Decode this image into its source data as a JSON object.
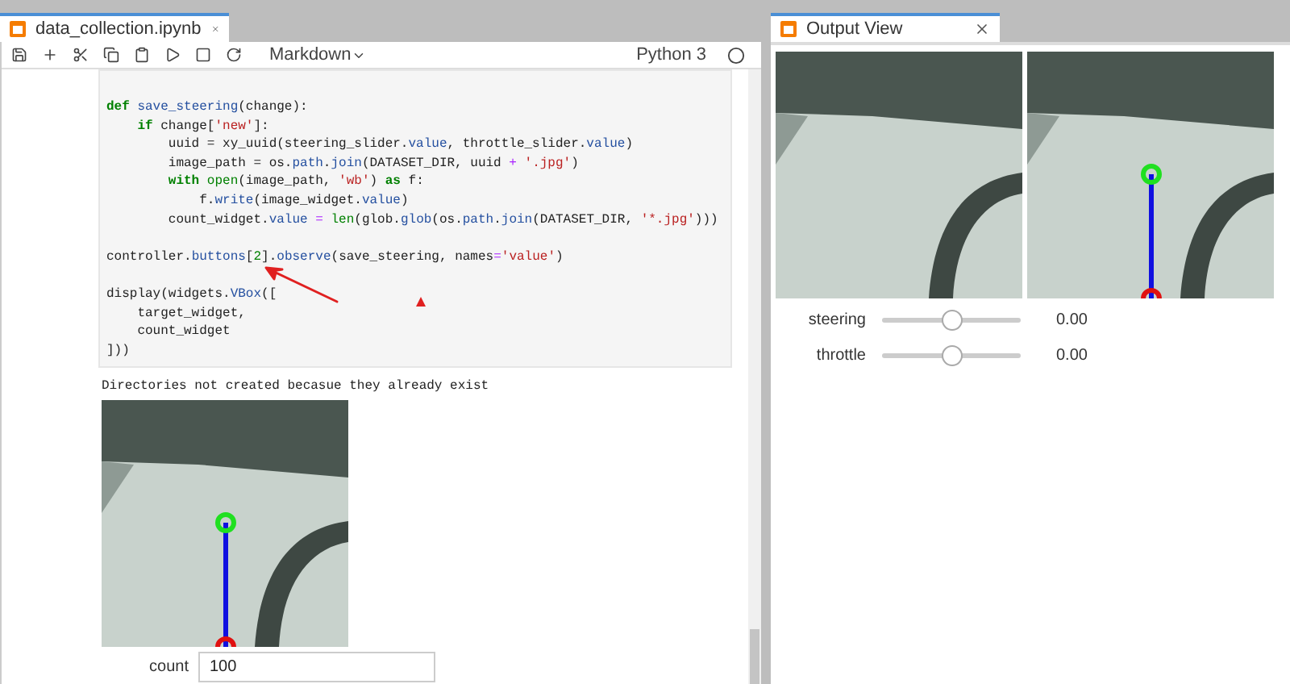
{
  "notebook": {
    "tab": {
      "title": "data_collection.ipynb",
      "selected": true
    },
    "toolbar": {
      "cell_type": "Markdown",
      "kernel": "Python 3"
    },
    "code_cell": {
      "blocks": [
        [
          [
            {
              "text": "def",
              "kind": "keyword"
            },
            {
              "text": " save_steering",
              "kind": "name"
            },
            {
              "text": "(change):",
              "kind": "plain"
            }
          ],
          [
            {
              "text": "    if",
              "kind": "keyword"
            },
            {
              "text": " change[",
              "kind": "plain"
            },
            {
              "text": "'new'",
              "kind": "string"
            },
            {
              "text": "]:",
              "kind": "plain"
            }
          ],
          [
            {
              "text": "        uuid = xy_uuid(steering_slider.",
              "kind": "plain"
            },
            {
              "text": "value",
              "kind": "name"
            },
            {
              "text": ", throttle_slider.",
              "kind": "plain"
            },
            {
              "text": "value",
              "kind": "name"
            },
            {
              "text": ")",
              "kind": "plain"
            }
          ],
          [
            {
              "text": "        image_path = os.",
              "kind": "plain"
            },
            {
              "text": "path",
              "kind": "name"
            },
            {
              "text": ".",
              "kind": "plain"
            },
            {
              "text": "join",
              "kind": "name"
            },
            {
              "text": "(DATASET_DIR, uuid",
              "kind": "plain"
            },
            {
              "text": " +",
              "kind": "operator"
            },
            {
              "text": " '.jpg'",
              "kind": "string"
            },
            {
              "text": ")",
              "kind": "plain"
            }
          ],
          [
            {
              "text": "        with",
              "kind": "keyword"
            },
            {
              "text": " open",
              "kind": "builtin"
            },
            {
              "text": "(image_path,",
              "kind": "plain"
            },
            {
              "text": " 'wb'",
              "kind": "string"
            },
            {
              "text": ")",
              "kind": "plain"
            },
            {
              "text": " as",
              "kind": "keyword"
            },
            {
              "text": " f:",
              "kind": "plain"
            }
          ],
          [
            {
              "text": "            f.",
              "kind": "plain"
            },
            {
              "text": "write",
              "kind": "name"
            },
            {
              "text": "(image_widget.",
              "kind": "plain"
            },
            {
              "text": "value",
              "kind": "name"
            },
            {
              "text": ")",
              "kind": "plain"
            }
          ],
          [
            {
              "text": "        count_widget.",
              "kind": "plain"
            },
            {
              "text": "value",
              "kind": "name"
            },
            {
              "text": " =",
              "kind": "operator"
            },
            {
              "text": " len",
              "kind": "builtin"
            },
            {
              "text": "(glob.",
              "kind": "plain"
            },
            {
              "text": "glob",
              "kind": "name"
            },
            {
              "text": "(os.",
              "kind": "plain"
            },
            {
              "text": "path",
              "kind": "name"
            },
            {
              "text": ".",
              "kind": "plain"
            },
            {
              "text": "join",
              "kind": "name"
            },
            {
              "text": "(DATASET_DIR,",
              "kind": "plain"
            },
            {
              "text": " '*.jpg'",
              "kind": "string"
            },
            {
              "text": ")))",
              "kind": "plain"
            }
          ]
        ],
        [
          [
            {
              "text": "controller.",
              "kind": "plain"
            },
            {
              "text": "buttons",
              "kind": "name"
            },
            {
              "text": "[",
              "kind": "plain"
            },
            {
              "text": "2",
              "kind": "number"
            },
            {
              "text": "].",
              "kind": "plain"
            },
            {
              "text": "observe",
              "kind": "name"
            },
            {
              "text": "(save_steering, names",
              "kind": "plain"
            },
            {
              "text": "=",
              "kind": "operator"
            },
            {
              "text": "'value'",
              "kind": "string"
            },
            {
              "text": ")",
              "kind": "plain"
            }
          ]
        ],
        [
          [
            {
              "text": "display(widgets.",
              "kind": "plain"
            },
            {
              "text": "VBox",
              "kind": "name"
            },
            {
              "text": "([",
              "kind": "plain"
            }
          ],
          [
            {
              "text": "    target_widget,",
              "kind": "plain"
            }
          ],
          [
            {
              "text": "    count_widget",
              "kind": "plain"
            }
          ],
          [
            {
              "text": "]))",
              "kind": "plain"
            }
          ]
        ]
      ]
    },
    "output": {
      "message": "Directories not created becasue they already exist",
      "count": {
        "label": "count",
        "value": "100"
      }
    }
  },
  "output_view": {
    "tab": {
      "title": "Output View",
      "selected": true
    },
    "sliders": [
      {
        "label": "steering",
        "level": 0.5,
        "reading": "0.00"
      },
      {
        "label": "throttle",
        "level": 0.5,
        "reading": "0.00"
      }
    ]
  }
}
